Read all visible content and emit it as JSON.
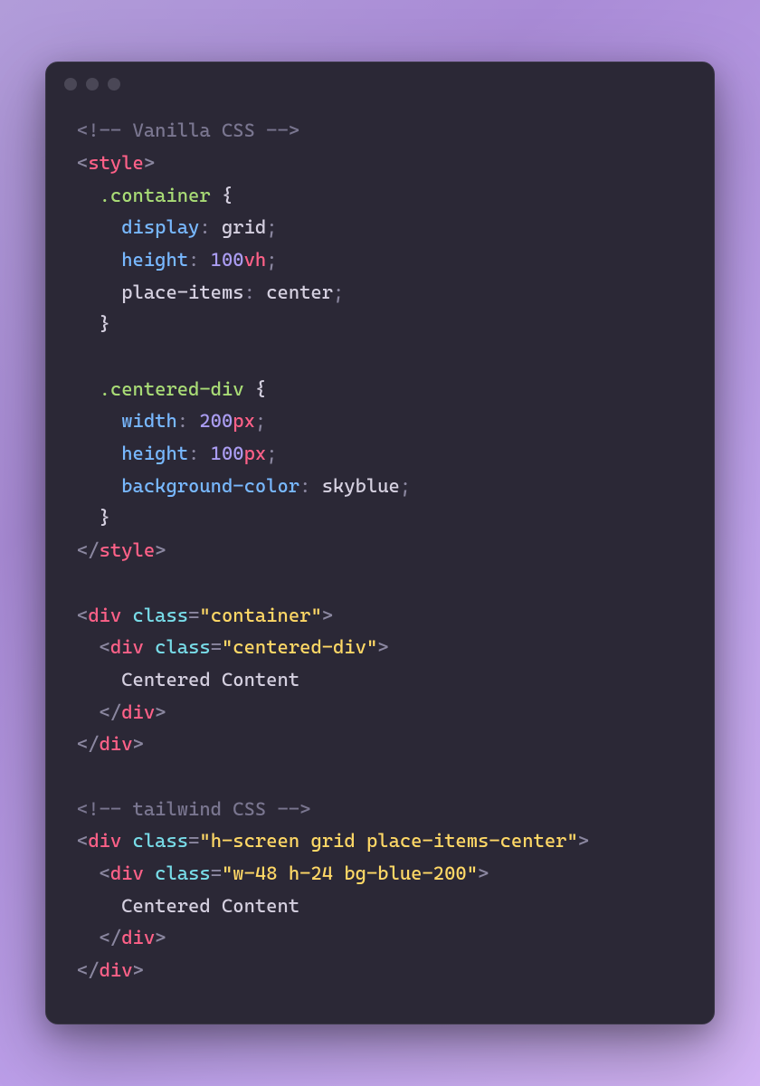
{
  "colors": {
    "bg_gradient_start": "#b19cd9",
    "bg_gradient_end": "#d4b5f5",
    "editor_bg": "#2b2836",
    "comment": "#7a7690",
    "tag": "#ff6188",
    "attr": "#78dce8",
    "string": "#ffd866",
    "selector": "#a9dc76",
    "prop": "#78b8ff",
    "number": "#ab9df2",
    "text": "#d5d0e0"
  },
  "code": {
    "comment1": "<!-- Vanilla CSS -->",
    "style_open": "style",
    "sel_container": ".container",
    "brace_open": "{",
    "prop_display": "display",
    "val_display": "grid",
    "prop_height": "height",
    "val_height_100vh_num": "100",
    "val_height_100vh_unit": "vh",
    "prop_placeitems": "place-items",
    "val_placeitems": "center",
    "brace_close": "}",
    "sel_centereddiv": ".centered-div",
    "prop_width": "width",
    "val_width_200px_num": "200",
    "val_width_200px_unit": "px",
    "val_height_100px_num": "100",
    "val_height_100px_unit": "px",
    "prop_bgcolor": "background-color",
    "val_bgcolor": "skyblue",
    "style_close": "style",
    "div": "div",
    "attr_class": "class",
    "str_container": "\"container\"",
    "str_centereddiv": "\"centered-div\"",
    "text_centered": "Centered Content",
    "comment2": "<!-- tailwind CSS -->",
    "str_tw_outer": "\"h-screen grid place-items-center\"",
    "str_tw_inner": "\"w-48 h-24 bg-blue-200\""
  }
}
